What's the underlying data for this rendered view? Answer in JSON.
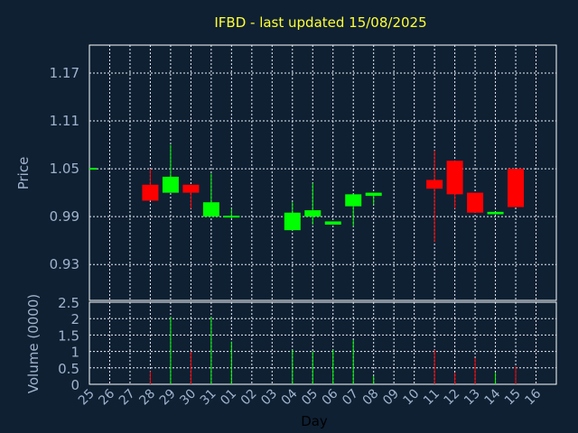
{
  "chart_data": {
    "type": "candlestick",
    "title": "IFBD - last updated 15/08/2025",
    "xlabel": "Day",
    "price_panel": {
      "ylabel": "Price",
      "ylim": [
        0.885,
        1.205
      ],
      "yticks": [
        0.93,
        0.99,
        1.05,
        1.11,
        1.17
      ],
      "grid": true
    },
    "volume_panel": {
      "ylabel": "Volume (0000)",
      "ylim": [
        0,
        2.5
      ],
      "yticks": [
        0,
        0.5,
        1,
        1.5,
        2,
        2.5
      ],
      "grid": true
    },
    "x_tick_labels": [
      "25",
      "26",
      "27",
      "28",
      "29",
      "30",
      "31",
      "01",
      "02",
      "03",
      "04",
      "05",
      "06",
      "07",
      "08",
      "09",
      "10",
      "11",
      "12",
      "13",
      "14",
      "15",
      "16"
    ],
    "colors": {
      "up": "#00ff00",
      "down": "#ff0000",
      "flat": "#00ff00"
    },
    "candles": [
      {
        "day": "25",
        "open": 1.05,
        "close": 1.05,
        "high": 1.05,
        "low": 1.05,
        "volume": 0
      },
      {
        "day": "28",
        "open": 1.03,
        "close": 1.01,
        "high": 1.05,
        "low": 1.01,
        "volume": 0.4
      },
      {
        "day": "29",
        "open": 1.02,
        "close": 1.04,
        "high": 1.08,
        "low": 1.02,
        "volume": 2.05
      },
      {
        "day": "30",
        "open": 1.03,
        "close": 1.02,
        "high": 1.03,
        "low": 1.0,
        "volume": 1.0
      },
      {
        "day": "31",
        "open": 0.99,
        "close": 1.008,
        "high": 1.044,
        "low": 0.99,
        "volume": 2.05
      },
      {
        "day": "01",
        "open": 0.988,
        "close": 0.99,
        "high": 1.0,
        "low": 0.988,
        "volume": 1.3
      },
      {
        "day": "04",
        "open": 0.973,
        "close": 0.995,
        "high": 1.008,
        "low": 0.973,
        "volume": 1.05
      },
      {
        "day": "05",
        "open": 0.99,
        "close": 0.998,
        "high": 1.032,
        "low": 0.98,
        "volume": 1.0
      },
      {
        "day": "06",
        "open": 0.98,
        "close": 0.984,
        "high": 0.984,
        "low": 0.98,
        "volume": 1.05
      },
      {
        "day": "07",
        "open": 1.003,
        "close": 1.018,
        "high": 1.018,
        "low": 0.978,
        "volume": 1.35
      },
      {
        "day": "08",
        "open": 1.016,
        "close": 1.02,
        "high": 1.02,
        "low": 1.005,
        "volume": 0.25
      },
      {
        "day": "11",
        "open": 1.036,
        "close": 1.025,
        "high": 1.073,
        "low": 0.958,
        "volume": 1.05
      },
      {
        "day": "12",
        "open": 1.06,
        "close": 1.018,
        "high": 1.06,
        "low": 1.0,
        "volume": 0.35
      },
      {
        "day": "13",
        "open": 1.02,
        "close": 0.995,
        "high": 1.02,
        "low": 0.995,
        "volume": 0.8
      },
      {
        "day": "14",
        "open": 0.993,
        "close": 0.996,
        "high": 0.996,
        "low": 0.993,
        "volume": 0.35
      },
      {
        "day": "15",
        "open": 1.05,
        "close": 1.002,
        "high": 1.05,
        "low": 1.002,
        "volume": 0.55
      }
    ]
  }
}
